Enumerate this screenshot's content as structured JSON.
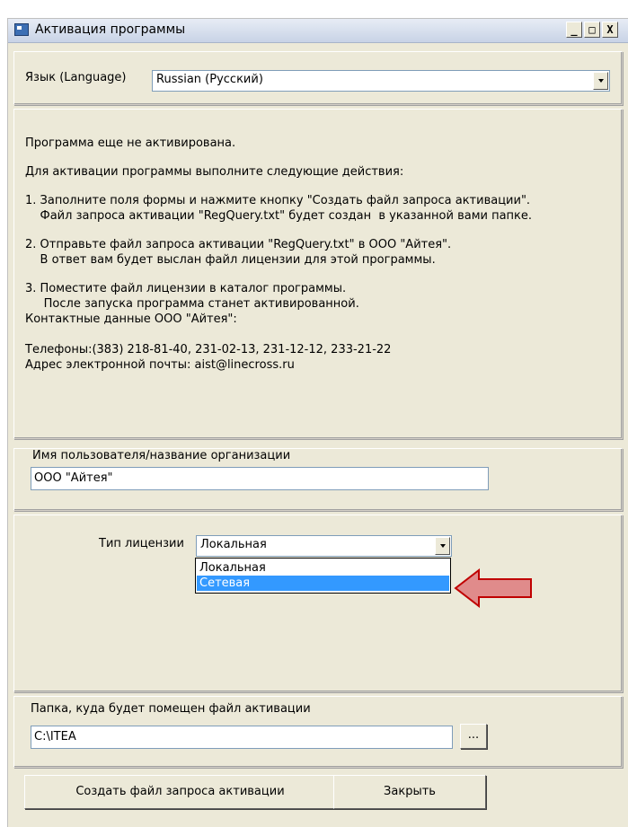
{
  "window": {
    "title": "Активация программы",
    "minimize": "_",
    "maximize": "□",
    "close": "X"
  },
  "language": {
    "label": "Язык (Language)",
    "value": "Russian (Русский)"
  },
  "info": {
    "lines": [
      "Программа еще не активирована.",
      "Для активации программы выполните следующие действия:",
      "1. Заполните поля формы и нажмите кнопку \"Создать файл запроса активации\".",
      "    Файл запроса активации \"RegQuery.txt\" будет создан  в указанной вами папке.",
      "2. Отправьте файл запроса активации \"RegQuery.txt\" в ООО \"Айтея\".",
      "    В ответ вам будет выслан файл лицензии для этой программы.",
      "3. Поместите файл лицензии в каталог программы.",
      "     После запуска программа станет активированной.",
      "Контактные данные ООО \"Айтея\":",
      "Телефоны:(383) 218-81-40, 231-02-13, 231-12-12, 233-21-22",
      "Адрес электронной почты: aist@linecross.ru"
    ]
  },
  "user": {
    "label": "Имя пользователя/название организации",
    "value": "ООО \"Айтея\""
  },
  "license": {
    "label": "Тип лицензии",
    "value": "Локальная",
    "options": [
      "Локальная",
      "Сетевая"
    ],
    "highlighted": "Сетевая"
  },
  "folder": {
    "label": "Папка, куда будет помещен файл активации",
    "value": "C:\\ITEA",
    "browse_label": "..."
  },
  "buttons": {
    "create": "Создать файл запроса активации",
    "close": "Закрыть"
  },
  "colors": {
    "selection": "#3399ff",
    "annotation_arrow": "#e08b8b",
    "annotation_arrow_border": "#c00000"
  }
}
